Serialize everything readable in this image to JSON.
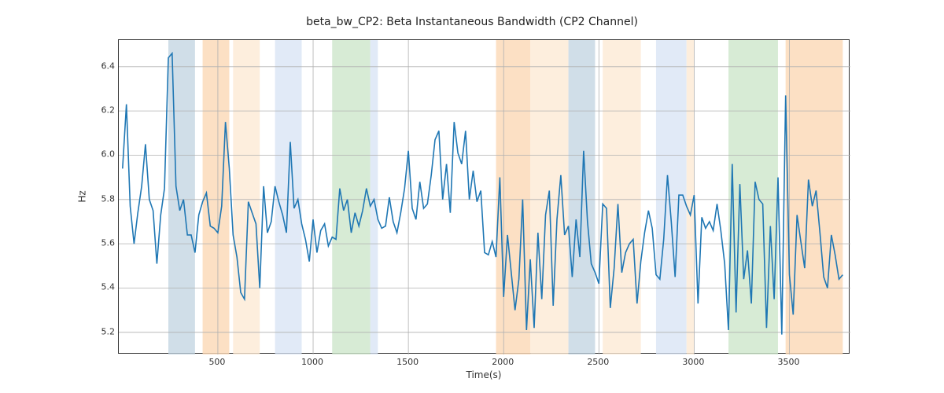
{
  "chart_data": {
    "type": "line",
    "title": "beta_bw_CP2: Beta Instantaneous Bandwidth (CP2 Channel)",
    "xlabel": "Time(s)",
    "ylabel": "Hz",
    "xlim": [
      -20,
      3820
    ],
    "ylim": [
      5.1,
      6.52
    ],
    "xticks": [
      500,
      1000,
      1500,
      2000,
      2500,
      3000,
      3500
    ],
    "yticks": [
      5.2,
      5.4,
      5.6,
      5.8,
      6.0,
      6.2,
      6.4
    ],
    "bands": [
      {
        "x0": 240,
        "x1": 380,
        "class": "band-blue"
      },
      {
        "x0": 420,
        "x1": 560,
        "class": "band-orange"
      },
      {
        "x0": 580,
        "x1": 720,
        "class": "band-ltornge"
      },
      {
        "x0": 800,
        "x1": 940,
        "class": "band-ltblue"
      },
      {
        "x0": 1100,
        "x1": 1300,
        "class": "band-green"
      },
      {
        "x0": 1300,
        "x1": 1340,
        "class": "band-ltblue"
      },
      {
        "x0": 1960,
        "x1": 2140,
        "class": "band-orange"
      },
      {
        "x0": 2140,
        "x1": 2340,
        "class": "band-ltornge"
      },
      {
        "x0": 2340,
        "x1": 2480,
        "class": "band-blue"
      },
      {
        "x0": 2520,
        "x1": 2720,
        "class": "band-ltornge"
      },
      {
        "x0": 2800,
        "x1": 2960,
        "class": "band-ltblue"
      },
      {
        "x0": 2960,
        "x1": 3000,
        "class": "band-ltornge"
      },
      {
        "x0": 3180,
        "x1": 3440,
        "class": "band-green"
      },
      {
        "x0": 3480,
        "x1": 3780,
        "class": "band-orange"
      }
    ],
    "series": [
      {
        "name": "beta_bw_CP2",
        "x": [
          0,
          20,
          40,
          60,
          80,
          100,
          120,
          140,
          160,
          180,
          200,
          220,
          240,
          260,
          280,
          300,
          320,
          340,
          360,
          380,
          400,
          420,
          440,
          460,
          480,
          500,
          520,
          540,
          560,
          580,
          600,
          620,
          640,
          660,
          680,
          700,
          720,
          740,
          760,
          780,
          800,
          820,
          840,
          860,
          880,
          900,
          920,
          940,
          960,
          980,
          1000,
          1020,
          1040,
          1060,
          1080,
          1100,
          1120,
          1140,
          1160,
          1180,
          1200,
          1220,
          1240,
          1260,
          1280,
          1300,
          1320,
          1340,
          1360,
          1380,
          1400,
          1420,
          1440,
          1460,
          1480,
          1500,
          1520,
          1540,
          1560,
          1580,
          1600,
          1620,
          1640,
          1660,
          1680,
          1700,
          1720,
          1740,
          1760,
          1780,
          1800,
          1820,
          1840,
          1860,
          1880,
          1900,
          1920,
          1940,
          1960,
          1980,
          2000,
          2020,
          2040,
          2060,
          2080,
          2100,
          2120,
          2140,
          2160,
          2180,
          2200,
          2220,
          2240,
          2260,
          2280,
          2300,
          2320,
          2340,
          2360,
          2380,
          2400,
          2420,
          2440,
          2460,
          2480,
          2500,
          2520,
          2540,
          2560,
          2580,
          2600,
          2620,
          2640,
          2660,
          2680,
          2700,
          2720,
          2740,
          2760,
          2780,
          2800,
          2820,
          2840,
          2860,
          2880,
          2900,
          2920,
          2940,
          2960,
          2980,
          3000,
          3020,
          3040,
          3060,
          3080,
          3100,
          3120,
          3140,
          3160,
          3180,
          3200,
          3220,
          3240,
          3260,
          3280,
          3300,
          3320,
          3340,
          3360,
          3380,
          3400,
          3420,
          3440,
          3460,
          3480,
          3500,
          3520,
          3540,
          3560,
          3580,
          3600,
          3620,
          3640,
          3660,
          3680,
          3700,
          3720,
          3740,
          3760,
          3780
        ],
        "y": [
          5.94,
          6.23,
          5.77,
          5.6,
          5.74,
          5.86,
          6.05,
          5.8,
          5.75,
          5.51,
          5.73,
          5.85,
          6.44,
          6.46,
          5.86,
          5.75,
          5.8,
          5.64,
          5.64,
          5.56,
          5.73,
          5.79,
          5.83,
          5.68,
          5.67,
          5.65,
          5.77,
          6.15,
          5.94,
          5.64,
          5.54,
          5.38,
          5.35,
          5.79,
          5.74,
          5.69,
          5.4,
          5.86,
          5.65,
          5.7,
          5.86,
          5.79,
          5.73,
          5.65,
          6.06,
          5.76,
          5.8,
          5.69,
          5.62,
          5.52,
          5.71,
          5.56,
          5.66,
          5.69,
          5.59,
          5.63,
          5.62,
          5.85,
          5.75,
          5.8,
          5.65,
          5.74,
          5.68,
          5.75,
          5.85,
          5.77,
          5.8,
          5.71,
          5.67,
          5.68,
          5.81,
          5.7,
          5.65,
          5.74,
          5.85,
          6.02,
          5.76,
          5.71,
          5.88,
          5.76,
          5.78,
          5.91,
          6.07,
          6.11,
          5.8,
          5.96,
          5.74,
          6.15,
          6.01,
          5.96,
          6.11,
          5.8,
          5.93,
          5.79,
          5.84,
          5.56,
          5.55,
          5.61,
          5.54,
          5.9,
          5.36,
          5.64,
          5.47,
          5.3,
          5.44,
          5.8,
          5.21,
          5.53,
          5.22,
          5.65,
          5.35,
          5.73,
          5.84,
          5.32,
          5.71,
          5.91,
          5.64,
          5.68,
          5.45,
          5.71,
          5.54,
          6.02,
          5.7,
          5.51,
          5.47,
          5.42,
          5.78,
          5.76,
          5.31,
          5.49,
          5.78,
          5.47,
          5.56,
          5.6,
          5.62,
          5.33,
          5.52,
          5.65,
          5.75,
          5.67,
          5.46,
          5.44,
          5.62,
          5.91,
          5.7,
          5.45,
          5.82,
          5.82,
          5.77,
          5.73,
          5.82,
          5.33,
          5.72,
          5.67,
          5.7,
          5.66,
          5.78,
          5.66,
          5.51,
          5.21,
          5.96,
          5.29,
          5.87,
          5.44,
          5.57,
          5.33,
          5.88,
          5.8,
          5.78,
          5.22,
          5.68,
          5.35,
          5.9,
          5.19,
          6.27,
          5.46,
          5.28,
          5.73,
          5.61,
          5.49,
          5.89,
          5.77,
          5.84,
          5.65,
          5.45,
          5.4,
          5.64,
          5.55,
          5.44,
          5.46
        ]
      }
    ]
  }
}
